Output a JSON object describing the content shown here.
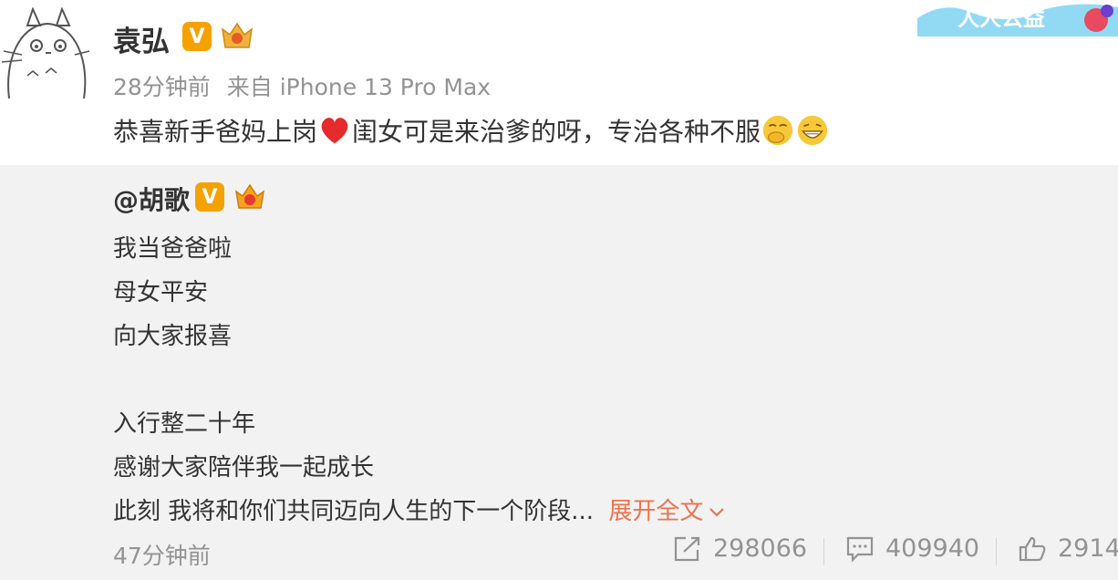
{
  "post": {
    "author": "袁弘",
    "time": "28分钟前",
    "source": "来自 iPhone 13 Pro Max",
    "text_part1": "恭喜新手爸妈上岗",
    "text_part2": "闺女可是来治爹的呀，专治各种不服",
    "emojis": [
      "heart-emoji",
      "cover-mouth-emoji",
      "grin-emoji"
    ]
  },
  "banner": {
    "text": "人人公益"
  },
  "retweet": {
    "author": "@胡歌",
    "lines": [
      "我当爸爸啦",
      "母女平安",
      "向大家报喜",
      "入行整二十年",
      "感谢大家陪伴我一起成长",
      "此刻 我将和你们共同迈向人生的下一个阶段..."
    ],
    "expand_label": "展开全文",
    "time": "47分钟前",
    "actions": {
      "forward_count": "298066",
      "comment_count": "409940",
      "like_count": "2914"
    }
  },
  "colors": {
    "accent": "#eb7350",
    "badge": "#f5a100",
    "retweet_bg": "#f2f2f2",
    "meta": "#939393"
  }
}
